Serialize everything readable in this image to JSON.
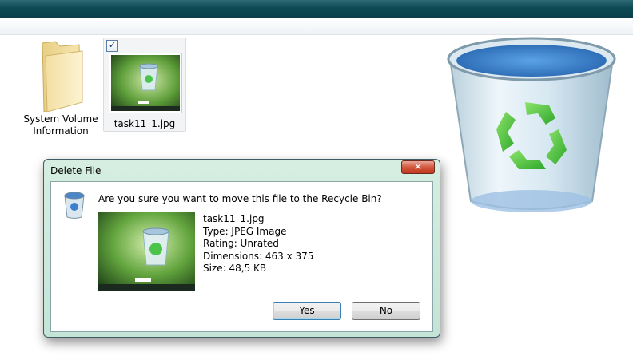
{
  "desktop": {
    "items": [
      {
        "label_line1": "System Volume",
        "label_line2": "Information",
        "icon": "folder-icon"
      },
      {
        "label": "task11_1.jpg",
        "icon": "image-thumbnail",
        "checked": true,
        "check_glyph": "✓"
      }
    ],
    "large_icon": "recycle-bin-icon"
  },
  "dialog": {
    "title": "Delete File",
    "close_glyph": "✕",
    "question": "Are you sure you want to move this file to the Recycle Bin?",
    "file": {
      "name": "task11_1.jpg",
      "type": "Type: JPEG Image",
      "rating": "Rating: Unrated",
      "dimensions": "Dimensions: 463 x 375",
      "size": "Size: 48,5 KB"
    },
    "buttons": {
      "yes": "Yes",
      "no": "No"
    }
  },
  "colors": {
    "titlebar": "#0c4a55",
    "dialog_frame": "#c4e4d6",
    "close_button": "#c1381f",
    "recycle_green": "#3fbf3a"
  }
}
